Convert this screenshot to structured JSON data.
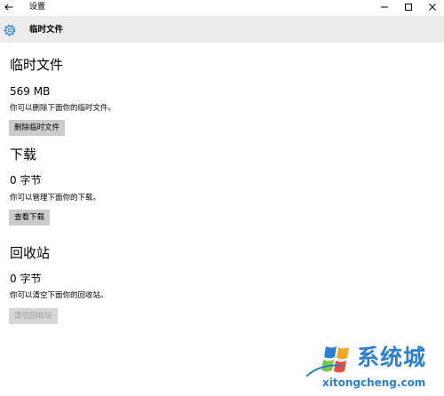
{
  "window": {
    "title": "设置"
  },
  "icons": {
    "back": "back-arrow-icon",
    "minimize": "minimize-icon",
    "maximize": "maximize-icon",
    "close": "close-icon",
    "settings": "gear-icon"
  },
  "header": {
    "title": "临时文件"
  },
  "temp_files": {
    "title": "临时文件",
    "size": "569 MB",
    "description": "你可以删除下面你的临时文件。",
    "button_label": "删除临时文件"
  },
  "downloads": {
    "title": "下载",
    "size": "0 字节",
    "description": "你可以管理下面你的下载。",
    "button_label": "查看下载"
  },
  "recycle_bin": {
    "title": "回收站",
    "size": "0 字节",
    "description": "你可以清空下面你的回收站。",
    "button_label": "清空回收站"
  },
  "watermark": {
    "brand": "系统城",
    "domain": "xitongcheng.com"
  },
  "colors": {
    "accent": "#2a7fd4",
    "header_bg": "#ececec",
    "button_bg": "#cccccc",
    "disabled_text": "#a0a0a0"
  }
}
